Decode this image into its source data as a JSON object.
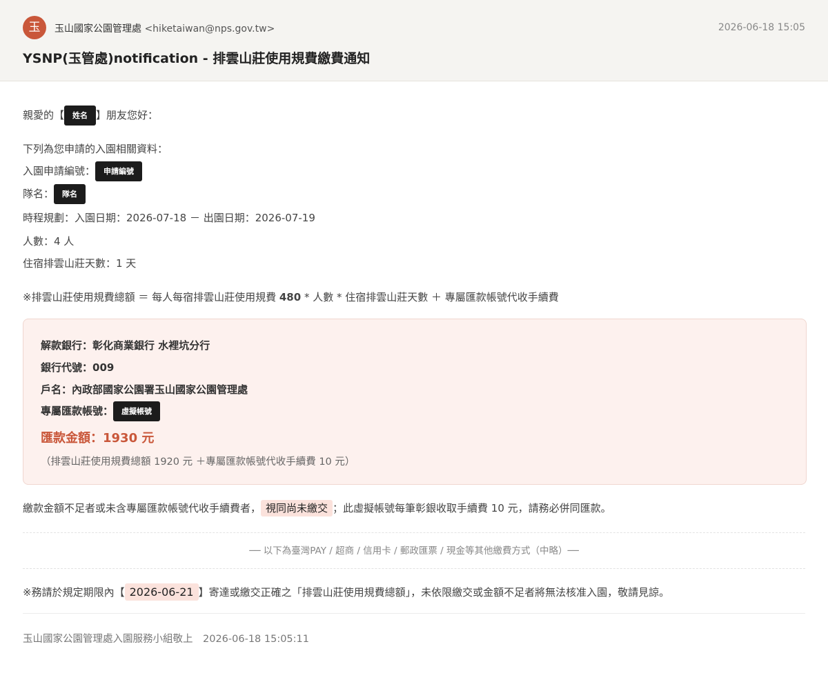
{
  "header": {
    "avatar_char": "玉",
    "sender_name": "玉山國家公園管理處",
    "sender_email": "<hiketaiwan@nps.gov.tw>",
    "date": "2026-06-18 15:05",
    "subject": "YSNP(玉管處)notification - 排雲山莊使用規費繳費通知"
  },
  "body": {
    "greeting_prefix": "親愛的【",
    "greeting_redacted": "姓名",
    "greeting_suffix": "】朋友您好：",
    "intro": "下列為您申請的入園相關資料：",
    "app_no_label": "入園申請編號：",
    "app_no_redacted": "申請編號",
    "team_label": "隊名：",
    "team_redacted": "隊名",
    "schedule": "時程規劃：入園日期：2026-07-18 － 出園日期：2026-07-19",
    "people": "人數：4 人",
    "nights": "住宿排雲山莊天數：1 天",
    "formula_prefix": "※排雲山莊使用規費總額 ＝ 每人每宿排雲山莊使用規費 ",
    "formula_fee": "480",
    "formula_suffix": " * 人數 * 住宿排雲山莊天數 ＋ 專屬匯款帳號代收手續費"
  },
  "bank": {
    "bank_line": "解款銀行：彰化商業銀行 水裡坑分行",
    "code_line": "銀行代號：009",
    "account_name_line": "戶名：內政部國家公園署玉山國家公園管理處",
    "account_label": "專屬匯款帳號：",
    "account_redacted": "虛擬帳號",
    "amount": "匯款金額：1930 元",
    "breakdown": "（排雲山莊使用規費總額 1920 元 ＋專屬匯款帳號代收手續費 10 元）"
  },
  "notice": {
    "prefix": "繳款金額不足者或未含專屬匯款帳號代收手續費者，",
    "highlight": "視同尚未繳交",
    "suffix": "；此虛擬帳號每筆彰銀收取手續費 10 元，請務必併同匯款。"
  },
  "other_methods": "── 以下為臺灣PAY / 超商 / 信用卡 / 郵政匯票 / 現金等其他繳費方式（中略）──",
  "deadline": {
    "prefix": "※務請於規定期限內【",
    "date": "2026-06-21",
    "suffix": "】寄達或繳交正確之「排雲山莊使用規費總額」，未依限繳交或金額不足者將無法核准入園，敬請見諒。"
  },
  "footer": "玉山國家公園管理處入園服務小組敬上　2026-06-18 15:05:11",
  "colors": {
    "accent": "#c9573a",
    "header_bg": "#f5f4f1",
    "panel_bg": "#fdf1ee",
    "highlight_bg": "#fbe2dc",
    "redaction": "#1c1c1c"
  }
}
